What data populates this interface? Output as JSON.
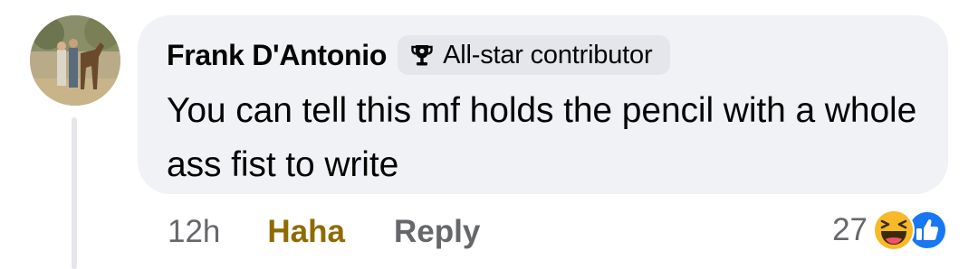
{
  "comment": {
    "author": {
      "name": "Frank D'Antonio",
      "badge_label": "All-star contributor",
      "badge_icon": "trophy-icon",
      "avatar": "profile-photo"
    },
    "text": "You can tell this mf holds the pencil with a whole ass fist to write",
    "timestamp": "12h",
    "actions": {
      "reaction_label": "Haha",
      "reply_label": "Reply"
    },
    "reactions": {
      "count": "27",
      "icons": [
        "haha-emoji-icon",
        "like-icon"
      ]
    }
  },
  "colors": {
    "bubble_background": "#f0f2f5",
    "badge_background": "#e4e6eb",
    "secondary_text": "#65676b",
    "haha_active": "#8f6a00",
    "like_blue": "#1877f2",
    "haha_yellow": "#f7b928"
  }
}
